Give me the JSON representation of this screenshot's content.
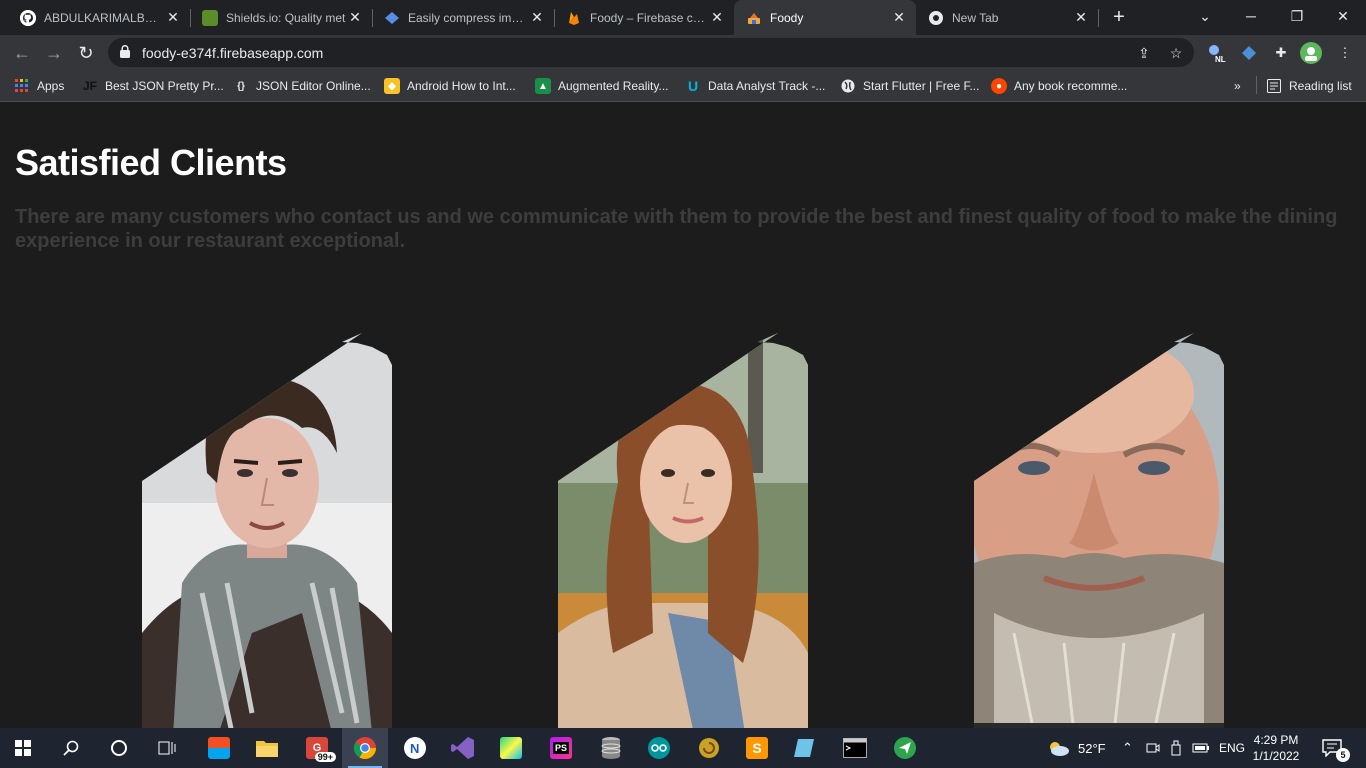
{
  "browser": {
    "tabs": [
      {
        "title": "ABDULKARIMALBAIK/",
        "icon": "github-icon"
      },
      {
        "title": "Shields.io: Quality met",
        "icon": "shields-icon"
      },
      {
        "title": "Easily compress image",
        "icon": "compress-icon"
      },
      {
        "title": "Foody – Firebase cons",
        "icon": "firebase-icon"
      },
      {
        "title": "Foody",
        "icon": "foody-icon",
        "active": true
      },
      {
        "title": "New Tab",
        "icon": "chrome-icon"
      }
    ],
    "url": "foody-e374f.firebaseapp.com",
    "extension_badge": "NL",
    "bookmarks": [
      {
        "label": "Apps",
        "icon": "apps-grid-icon"
      },
      {
        "label": "Best JSON Pretty Pr...",
        "icon": "jf-icon"
      },
      {
        "label": "JSON Editor Online...",
        "icon": "braces-icon"
      },
      {
        "label": "Android How to Int...",
        "icon": "android-icon"
      },
      {
        "label": "Augmented Reality...",
        "icon": "ar-icon"
      },
      {
        "label": "Data Analyst Track -...",
        "icon": "udacity-icon"
      },
      {
        "label": "Start Flutter | Free F...",
        "icon": "globe-icon"
      },
      {
        "label": "Any book recomme...",
        "icon": "reddit-icon"
      }
    ],
    "reading_list": "Reading list"
  },
  "page": {
    "heading": "Satisfied Clients",
    "lead": "There are many customers who contact us and we communicate with them to provide the best and finest quality of food to make the dining experience in our restaurant exceptional.",
    "clients": [
      {
        "name": "client-young-man",
        "bg": "#d8d8d8"
      },
      {
        "name": "client-woman",
        "bg": "#7a8a6a"
      },
      {
        "name": "client-bearded-man",
        "bg": "#aeb4b8"
      }
    ]
  },
  "taskbar": {
    "notification_badge": "99+",
    "weather": "52°F",
    "language": "ENG",
    "time": "4:29 PM",
    "date": "1/1/2022",
    "notifications_count": "5"
  },
  "colors": {
    "page_bg": "#1c1c1c",
    "heading": "#ffffff",
    "lead_text": "#3d3d3d",
    "tab_active": "#35363a",
    "tab_strip": "#202124",
    "taskbar": "#1f2530"
  }
}
